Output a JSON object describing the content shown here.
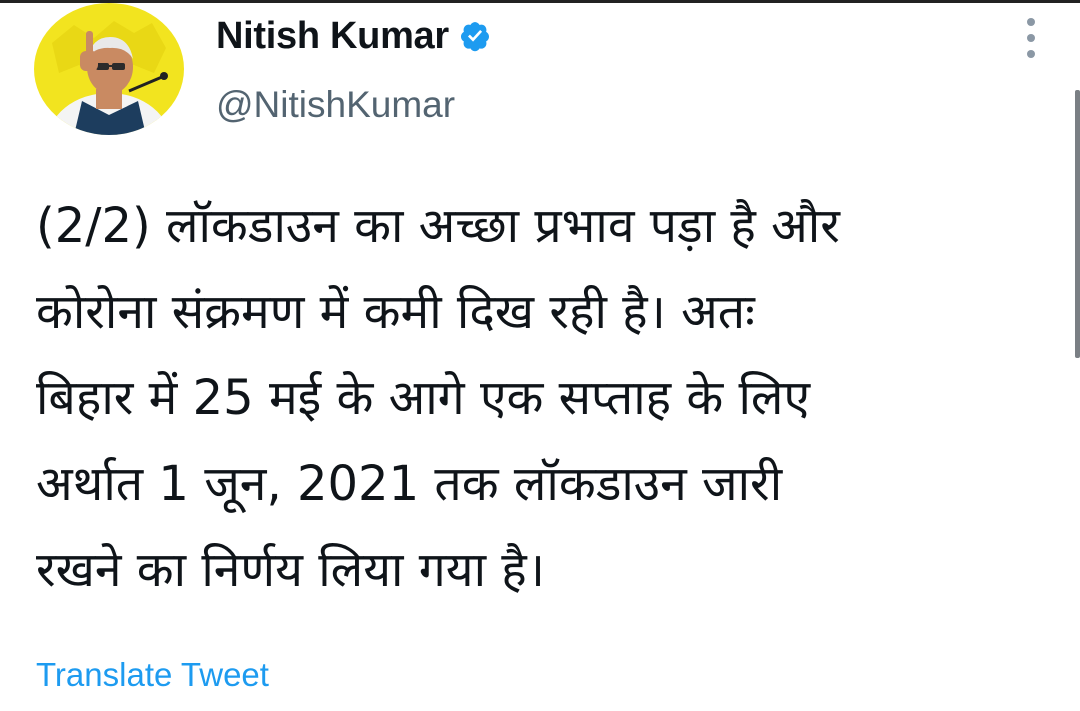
{
  "author": {
    "display_name": "Nitish Kumar",
    "handle": "@NitishKumar",
    "verified": true,
    "avatar_icon": "profile-photo"
  },
  "tweet": {
    "lines": [
      "(2/2) लॉकडाउन का अच्छा प्रभाव पड़ा है और",
      "कोरोना संक्रमण में कमी दिख रही है। अतः",
      "बिहार में 25 मई के आगे एक सप्ताह के लिए",
      "अर्थात 1 जून, 2021 तक लॉकडाउन जारी",
      "रखने का निर्णय लिया गया है।"
    ]
  },
  "actions": {
    "translate_label": "Translate Tweet",
    "more_icon": "vertical-ellipsis-icon"
  },
  "colors": {
    "link_blue": "#1d9bf0",
    "secondary_text": "#536471",
    "primary_text": "#0f1419",
    "verified_badge": "#1d9bf0",
    "avatar_background": "#f2e41f"
  }
}
